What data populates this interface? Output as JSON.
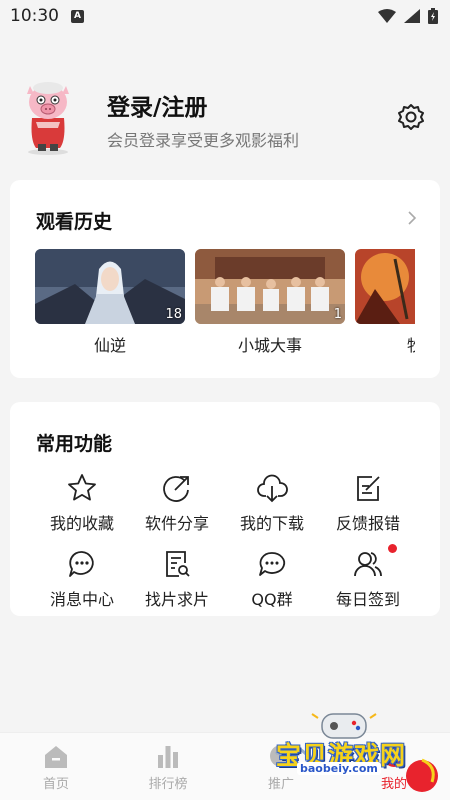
{
  "status": {
    "time": "10:30"
  },
  "profile": {
    "title": "登录/注册",
    "subtitle": "会员登录享受更多观影福利"
  },
  "history": {
    "title": "观看历史",
    "items": [
      {
        "label": "仙逆",
        "episode": "18"
      },
      {
        "label": "小城大事",
        "episode": "1"
      },
      {
        "label": "牧",
        "episode": ""
      }
    ]
  },
  "functions": {
    "title": "常用功能",
    "items": [
      {
        "label": "我的收藏",
        "icon": "star-icon"
      },
      {
        "label": "软件分享",
        "icon": "share-icon"
      },
      {
        "label": "我的下载",
        "icon": "cloud-download-icon"
      },
      {
        "label": "反馈报错",
        "icon": "feedback-icon"
      },
      {
        "label": "消息中心",
        "icon": "message-icon"
      },
      {
        "label": "找片求片",
        "icon": "search-document-icon"
      },
      {
        "label": "QQ群",
        "icon": "chat-group-icon"
      },
      {
        "label": "每日签到",
        "icon": "users-icon"
      }
    ]
  },
  "tabbar": {
    "items": [
      {
        "label": "首页",
        "icon": "home-icon"
      },
      {
        "label": "排行榜",
        "icon": "bar-chart-icon"
      },
      {
        "label": "推广",
        "icon": "promote-icon"
      },
      {
        "label": "我的",
        "icon": "profile-icon",
        "active": true
      }
    ]
  },
  "watermark": {
    "text": "宝贝游戏网",
    "url": "baobeiy.com"
  },
  "colors": {
    "accent": "#e8232d",
    "background": "#f4f4f4",
    "card": "#ffffff"
  }
}
